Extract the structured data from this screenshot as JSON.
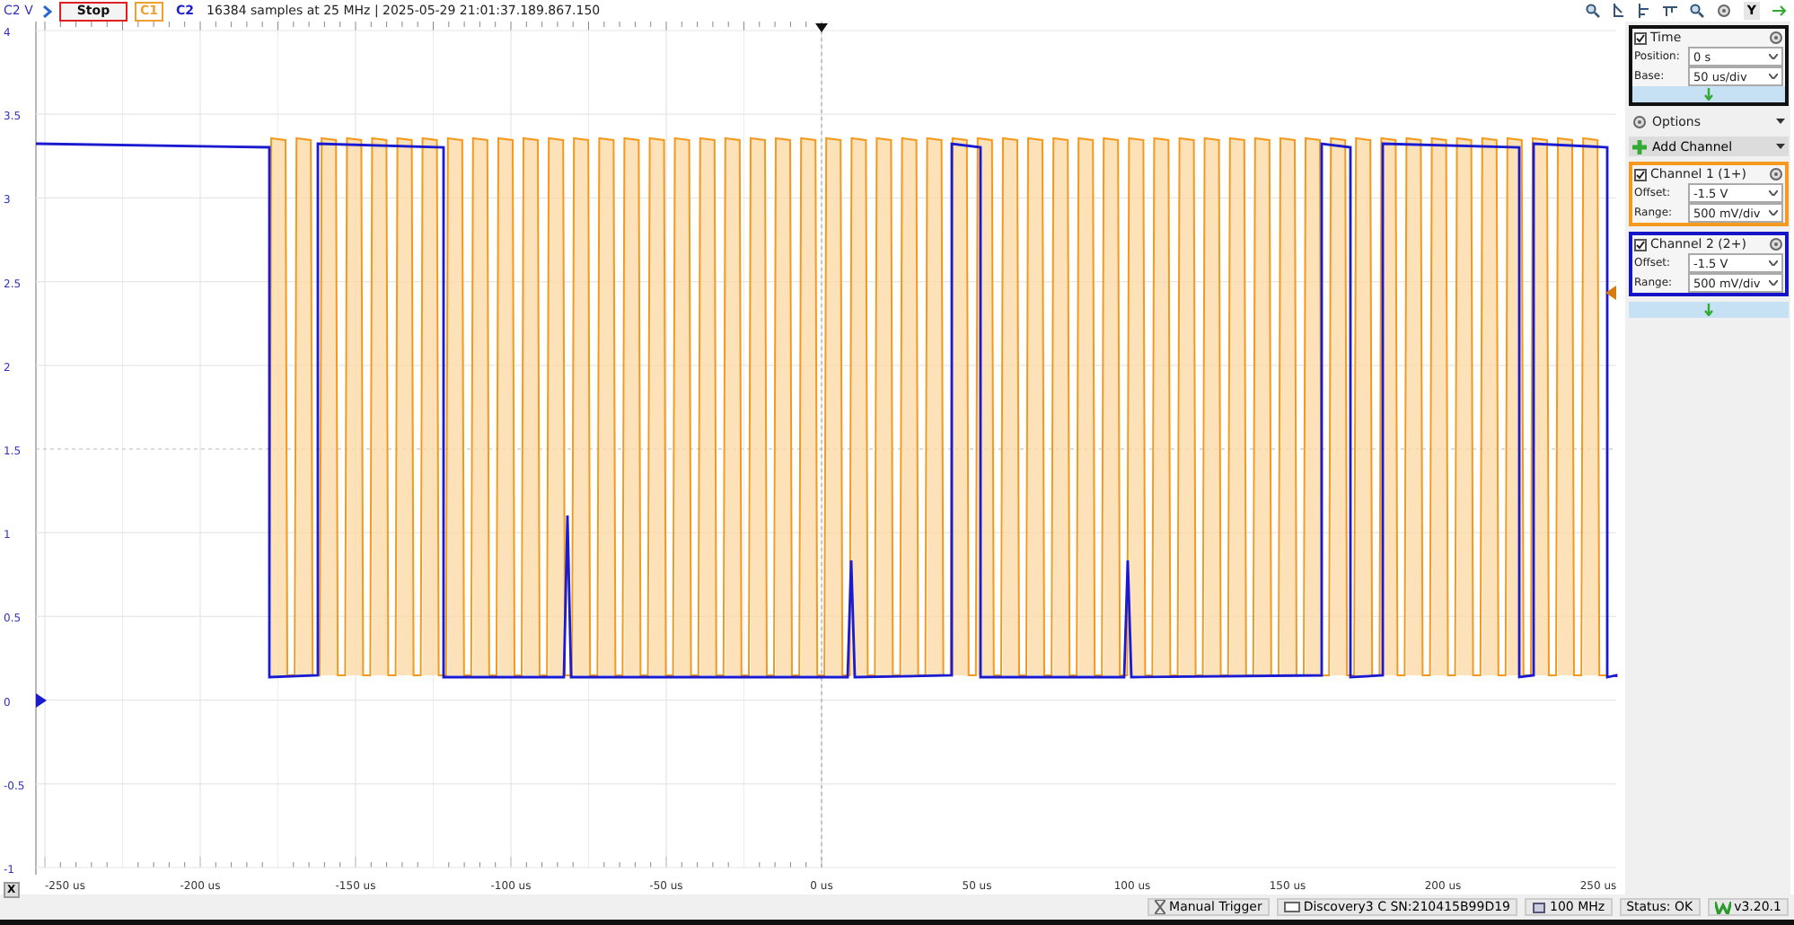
{
  "toolbar": {
    "axis_label": "C2 V",
    "run_button": "Stop",
    "channel_tags": [
      {
        "label": "C1",
        "color": "#f0a030"
      },
      {
        "label": "C2",
        "color": "#2020d0"
      }
    ],
    "info": "16384 samples at 25 MHz | 2025-05-29 21:01:37.189.867.150",
    "y_button": "Y"
  },
  "plot": {
    "y_ticks": [
      "4",
      "3.5",
      "3",
      "2.5",
      "2",
      "1.5",
      "1",
      "0.5",
      "0",
      "-0.5",
      "-1"
    ],
    "x_ticks": [
      "-250 us",
      "-200 us",
      "-150 us",
      "-100 us",
      "-50 us",
      "0 us",
      "50 us",
      "100 us",
      "150 us",
      "200 us",
      "250 us"
    ]
  },
  "x_button": "X",
  "panel": {
    "time": {
      "title": "Time",
      "checked": true,
      "fields": [
        {
          "label": "Position:",
          "value": "0 s"
        },
        {
          "label": "Base:",
          "value": "50 us/div"
        }
      ]
    },
    "options": "Options",
    "add_channel": "Add Channel",
    "channels": [
      {
        "title": "Channel 1 (1+)",
        "checked": true,
        "color": "#f59a1f",
        "fields": [
          {
            "label": "Offset:",
            "value": "-1.5 V"
          },
          {
            "label": "Range:",
            "value": "500 mV/div"
          }
        ]
      },
      {
        "title": "Channel 2 (2+)",
        "checked": true,
        "color": "#1515c8",
        "fields": [
          {
            "label": "Offset:",
            "value": "-1.5 V"
          },
          {
            "label": "Range:",
            "value": "500 mV/div"
          }
        ]
      }
    ]
  },
  "status_bar": [
    {
      "kind": "trigger",
      "label": "Manual Trigger"
    },
    {
      "kind": "device",
      "label": "Discovery3 C SN:210415B99D19"
    },
    {
      "kind": "clock",
      "label": "100 MHz"
    },
    {
      "kind": "status",
      "label": "Status: OK"
    },
    {
      "kind": "version",
      "label": "v3.20.1"
    }
  ]
}
